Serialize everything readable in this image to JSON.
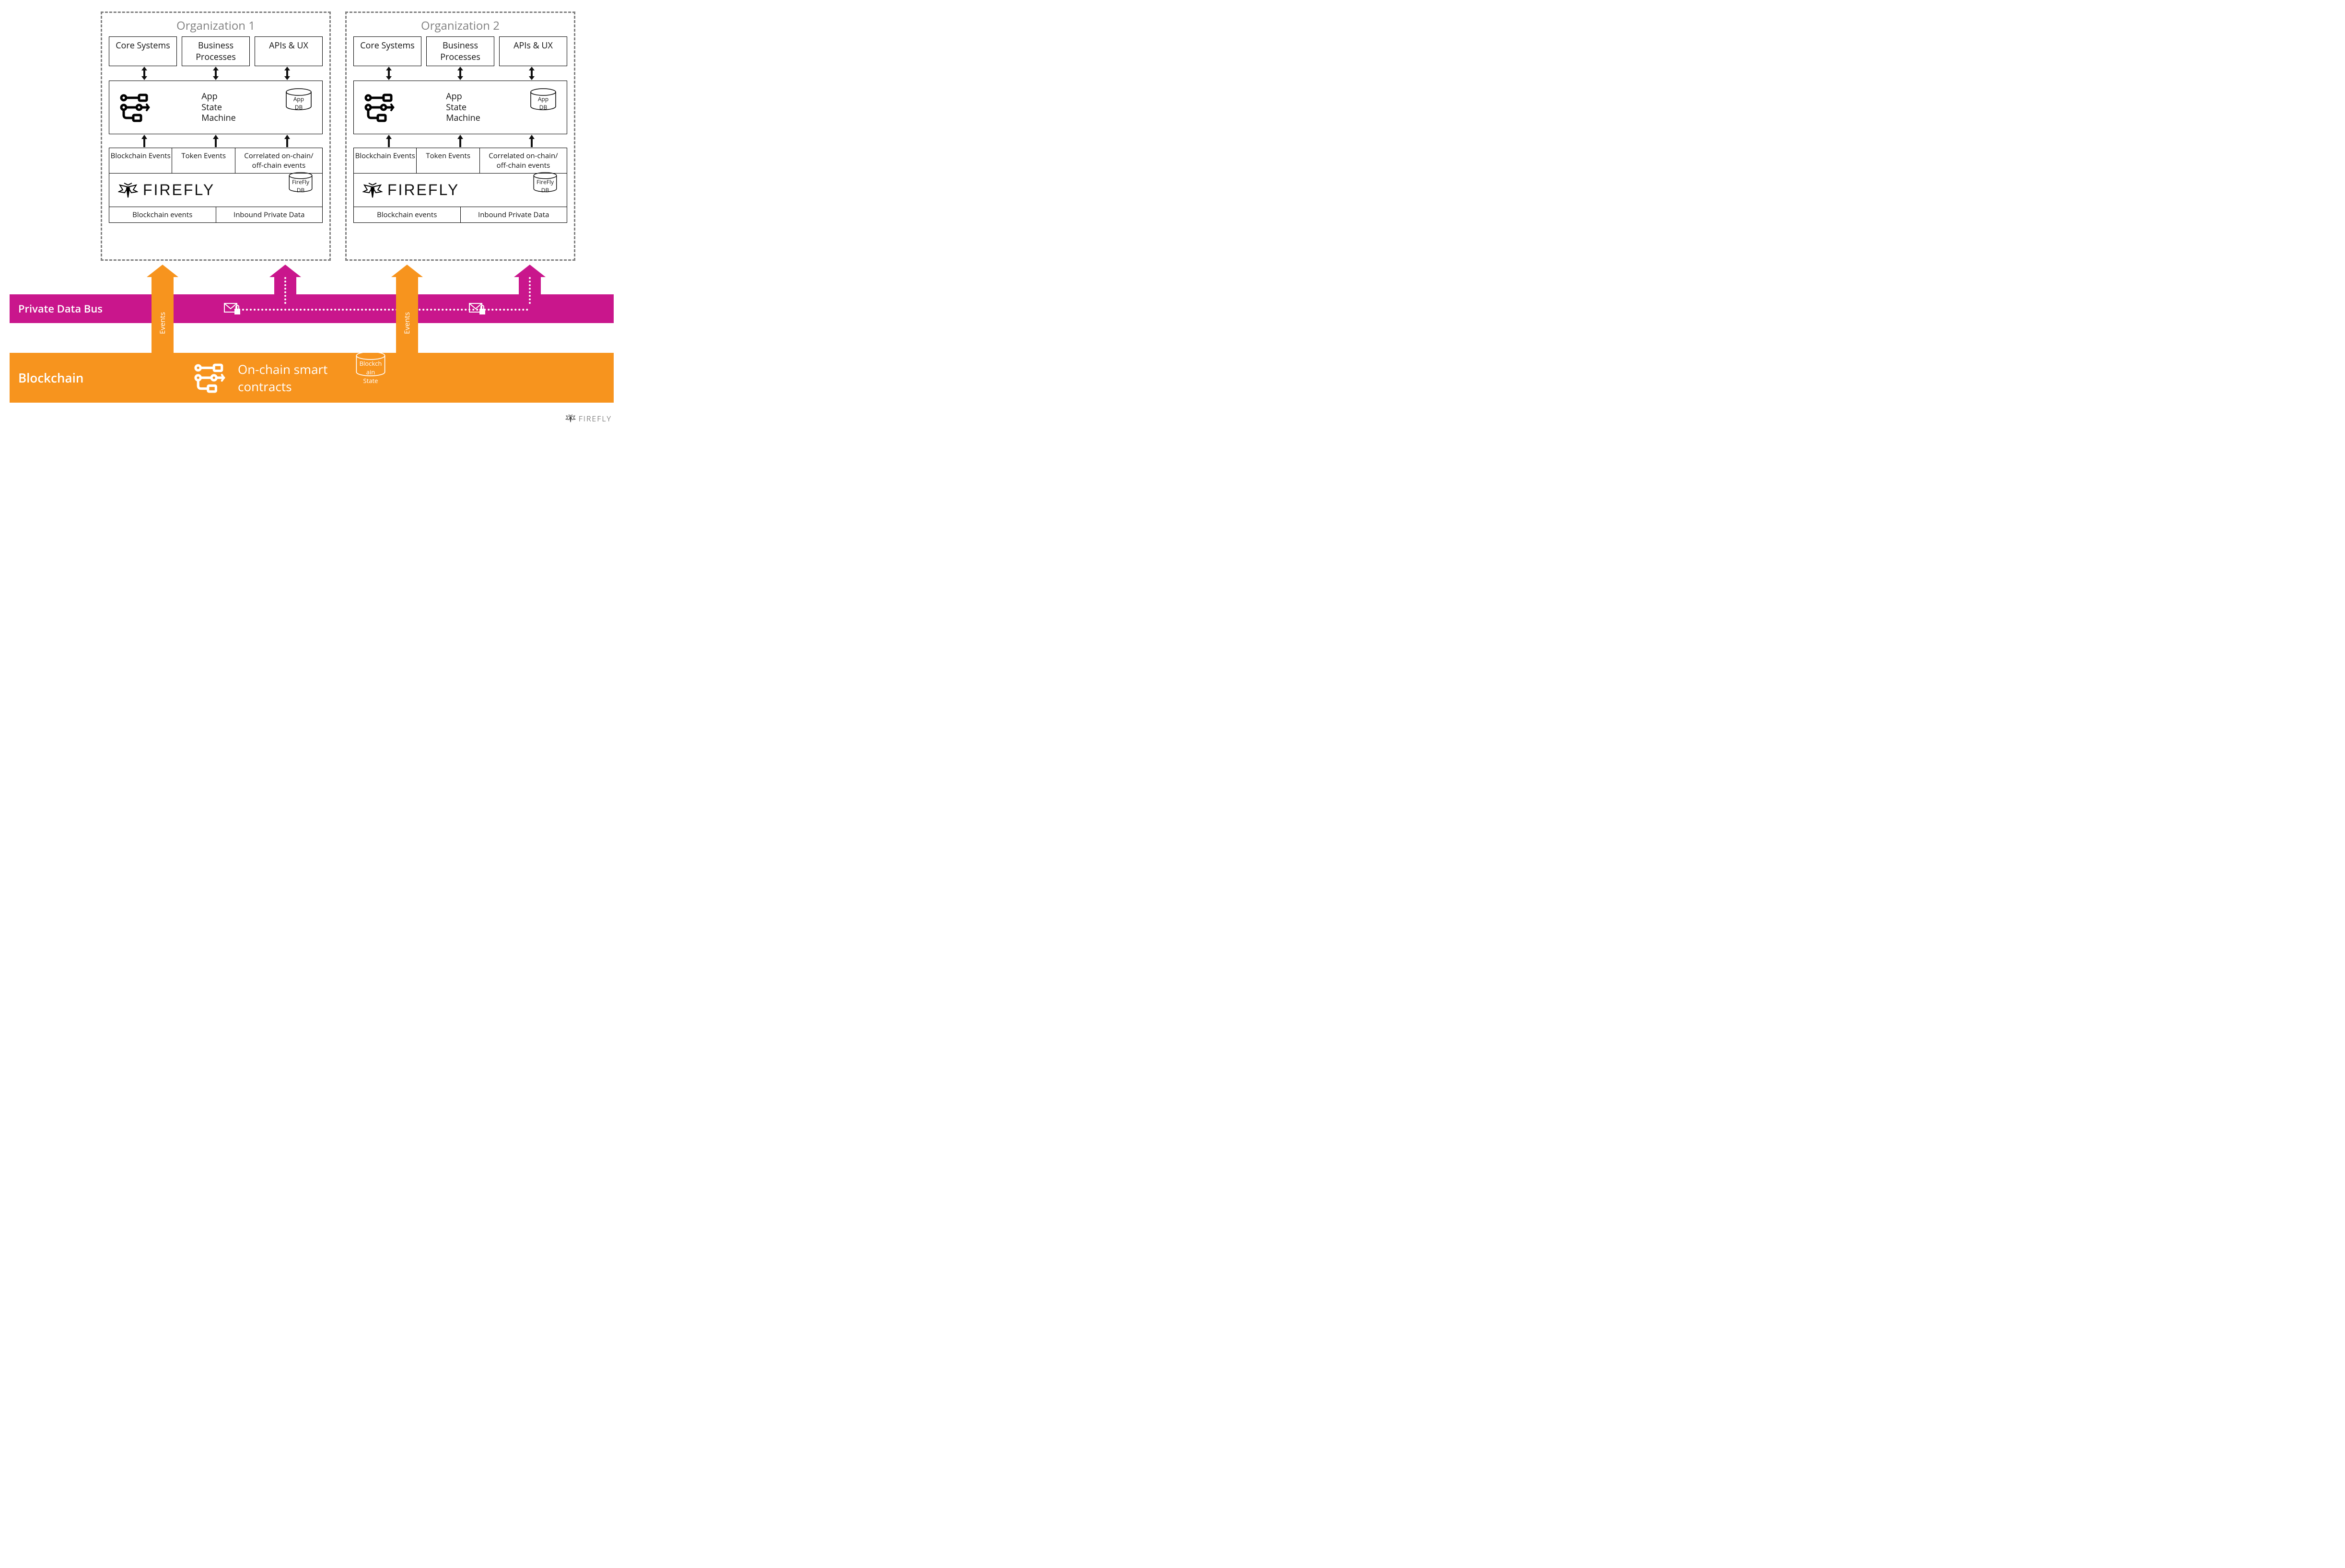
{
  "orgs": [
    {
      "title": "Organization 1"
    },
    {
      "title": "Organization 2"
    }
  ],
  "top_boxes": [
    "Core Systems",
    "Business Processes",
    "APIs & UX"
  ],
  "app_state_machine": "App\nState\nMachine",
  "app_db_label": "App\nDB",
  "events_row": [
    "Blockchain Events",
    "Token Events",
    "Correlated on-chain/\noff-chain events"
  ],
  "firefly_word": "FIREFLY",
  "firefly_db_label": "FireFly\nDB",
  "bottom_row": [
    "Blockchain events",
    "Inbound Private Data"
  ],
  "events_arrow_label": "Events",
  "private_bus_label": "Private Data Bus",
  "blockchain_label": "Blockchain",
  "onchain_label": "On-chain smart\ncontracts",
  "blockchain_state_label": "Blockch\nain\nState",
  "footer_word": "FIREFLY"
}
